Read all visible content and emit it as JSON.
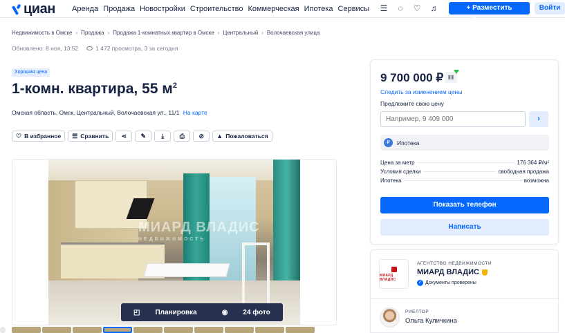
{
  "header": {
    "logo_text": "циан",
    "nav": [
      "Аренда",
      "Продажа",
      "Новостройки",
      "Строительство",
      "Коммерческая",
      "Ипотека",
      "Сервисы"
    ],
    "post_button": "+ Разместить объявление",
    "login_button": "Войти"
  },
  "breadcrumbs": [
    "Недвижимость в Омске",
    "Продажа",
    "Продажа 1-комнатных квартир в Омске",
    "Центральный",
    "Волочаевская улица"
  ],
  "meta": {
    "updated": "Обновлено: 8 ноя, 13:52",
    "views": "1 472 просмотра, 3 за сегодня"
  },
  "listing": {
    "badge": "Хорошая цена",
    "title": "1-комн. квартира, 55 м",
    "title_sup": "2",
    "address": "Омская область, Омск, Центральный, Волочаевская ул., 11/1",
    "map_link": "На карте"
  },
  "actions": {
    "favorite": "В избранное",
    "compare": "Сравнить",
    "complain": "Пожаловаться"
  },
  "gallery": {
    "watermark": "МИАРД ВЛАДИС",
    "watermark_sub": "НЕДВИЖИМОСТЬ",
    "plan_label": "Планировка",
    "photos_label": "24 фото"
  },
  "price_card": {
    "price": "9 700 000 ₽",
    "follow_link": "Следить за изменением цены",
    "offer_label": "Предложите свою цену",
    "offer_placeholder": "Например, 9 409 000",
    "mortgage_label": "Ипотека",
    "rows": [
      {
        "label": "Цена за метр",
        "value": "176 364 ₽/м²"
      },
      {
        "label": "Условия сделки",
        "value": "свободная продажа"
      },
      {
        "label": "Ипотека",
        "value": "возможна"
      }
    ],
    "phone_button": "Показать телефон",
    "write_button": "Написать"
  },
  "agency": {
    "logo_text": "МИАРД ВЛАДИС",
    "type": "АГЕНТСТВО НЕДВИЖИМОСТИ",
    "name": "МИАРД ВЛАДИС",
    "verified": "Документы проверены",
    "realtor_type": "РИЕЛТОР",
    "realtor_name": "Ольга Куличкина"
  },
  "colors": {
    "accent": "#0468ff",
    "text": "#152242",
    "muted": "#7a7f90",
    "light_accent": "#e4edfd"
  }
}
